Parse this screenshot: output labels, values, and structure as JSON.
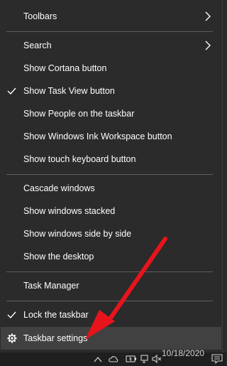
{
  "menu": {
    "toolbars": "Toolbars",
    "search": "Search",
    "show_cortana": "Show Cortana button",
    "show_task_view": "Show Task View button",
    "show_people": "Show People on the taskbar",
    "show_ink": "Show Windows Ink Workspace button",
    "show_touch_kb": "Show touch keyboard button",
    "cascade": "Cascade windows",
    "stacked": "Show windows stacked",
    "side_by_side": "Show windows side by side",
    "show_desktop": "Show the desktop",
    "task_manager": "Task Manager",
    "lock_taskbar": "Lock the taskbar",
    "taskbar_settings": "Taskbar settings"
  },
  "taskbar": {
    "date": "10/18/2020"
  },
  "icons": {
    "check": "checkmark-icon",
    "submenu": "chevron-right-icon",
    "settings": "gear-icon"
  },
  "colors": {
    "menu_bg": "#2b2b2b",
    "highlight": "#414141",
    "annotation_arrow": "#e8141b"
  }
}
